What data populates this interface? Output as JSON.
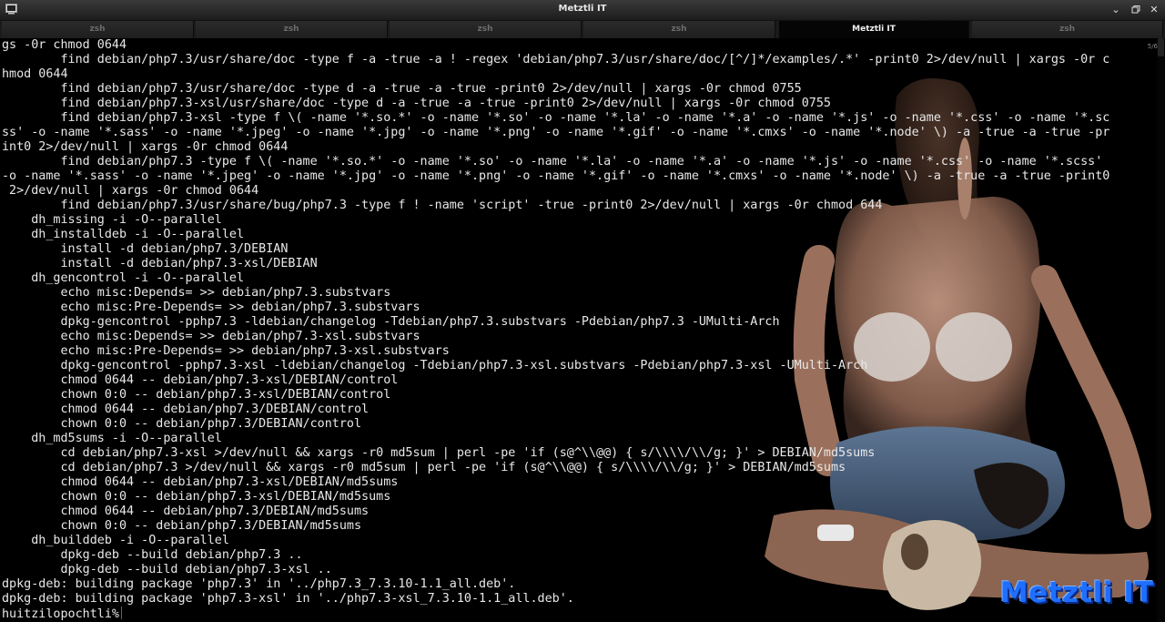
{
  "window": {
    "title": "Metztli IT",
    "icon": "terminal-icon",
    "controls": [
      "chevron-down-icon",
      "maximize-icon",
      "close-icon"
    ]
  },
  "tabs": [
    {
      "label": "zsh",
      "active": false
    },
    {
      "label": "zsh",
      "active": false
    },
    {
      "label": "zsh",
      "active": false
    },
    {
      "label": "zsh",
      "active": false
    },
    {
      "label": "Metztli IT",
      "active": true
    },
    {
      "label": "zsh",
      "active": false
    }
  ],
  "terminal": {
    "scroll_indicator": "5/6",
    "prompt": "huitzilopochtli%",
    "brand_overlay": "Metztli IT",
    "lines": [
      "gs -0r chmod 0644",
      "        find debian/php7.3/usr/share/doc -type f -a -true -a ! -regex 'debian/php7.3/usr/share/doc/[^/]*/examples/.*' -print0 2>/dev/null | xargs -0r c",
      "hmod 0644",
      "        find debian/php7.3/usr/share/doc -type d -a -true -a -true -print0 2>/dev/null | xargs -0r chmod 0755",
      "        find debian/php7.3-xsl/usr/share/doc -type d -a -true -a -true -print0 2>/dev/null | xargs -0r chmod 0755",
      "        find debian/php7.3-xsl -type f \\( -name '*.so.*' -o -name '*.so' -o -name '*.la' -o -name '*.a' -o -name '*.js' -o -name '*.css' -o -name '*.sc",
      "ss' -o -name '*.sass' -o -name '*.jpeg' -o -name '*.jpg' -o -name '*.png' -o -name '*.gif' -o -name '*.cmxs' -o -name '*.node' \\) -a -true -a -true -pr",
      "int0 2>/dev/null | xargs -0r chmod 0644",
      "        find debian/php7.3 -type f \\( -name '*.so.*' -o -name '*.so' -o -name '*.la' -o -name '*.a' -o -name '*.js' -o -name '*.css' -o -name '*.scss'",
      "-o -name '*.sass' -o -name '*.jpeg' -o -name '*.jpg' -o -name '*.png' -o -name '*.gif' -o -name '*.cmxs' -o -name '*.node' \\) -a -true -a -true -print0",
      " 2>/dev/null | xargs -0r chmod 0644",
      "        find debian/php7.3/usr/share/bug/php7.3 -type f ! -name 'script' -true -print0 2>/dev/null | xargs -0r chmod 644",
      "    dh_missing -i -O--parallel",
      "    dh_installdeb -i -O--parallel",
      "        install -d debian/php7.3/DEBIAN",
      "        install -d debian/php7.3-xsl/DEBIAN",
      "    dh_gencontrol -i -O--parallel",
      "        echo misc:Depends= >> debian/php7.3.substvars",
      "        echo misc:Pre-Depends= >> debian/php7.3.substvars",
      "        dpkg-gencontrol -pphp7.3 -ldebian/changelog -Tdebian/php7.3.substvars -Pdebian/php7.3 -UMulti-Arch",
      "        echo misc:Depends= >> debian/php7.3-xsl.substvars",
      "        echo misc:Pre-Depends= >> debian/php7.3-xsl.substvars",
      "        dpkg-gencontrol -pphp7.3-xsl -ldebian/changelog -Tdebian/php7.3-xsl.substvars -Pdebian/php7.3-xsl -UMulti-Arch",
      "        chmod 0644 -- debian/php7.3-xsl/DEBIAN/control",
      "        chown 0:0 -- debian/php7.3-xsl/DEBIAN/control",
      "        chmod 0644 -- debian/php7.3/DEBIAN/control",
      "        chown 0:0 -- debian/php7.3/DEBIAN/control",
      "    dh_md5sums -i -O--parallel",
      "        cd debian/php7.3-xsl >/dev/null && xargs -r0 md5sum | perl -pe 'if (s@^\\\\@@) { s/\\\\\\\\/\\\\/g; }' > DEBIAN/md5sums",
      "        cd debian/php7.3 >/dev/null && xargs -r0 md5sum | perl -pe 'if (s@^\\\\@@) { s/\\\\\\\\/\\\\/g; }' > DEBIAN/md5sums",
      "        chmod 0644 -- debian/php7.3-xsl/DEBIAN/md5sums",
      "        chown 0:0 -- debian/php7.3-xsl/DEBIAN/md5sums",
      "        chmod 0644 -- debian/php7.3/DEBIAN/md5sums",
      "        chown 0:0 -- debian/php7.3/DEBIAN/md5sums",
      "    dh_builddeb -i -O--parallel",
      "        dpkg-deb --build debian/php7.3 ..",
      "        dpkg-deb --build debian/php7.3-xsl ..",
      "dpkg-deb: building package 'php7.3' in '../php7.3_7.3.10-1.1_all.deb'.",
      "dpkg-deb: building package 'php7.3-xsl' in '../php7.3-xsl_7.3.10-1.1_all.deb'."
    ]
  }
}
